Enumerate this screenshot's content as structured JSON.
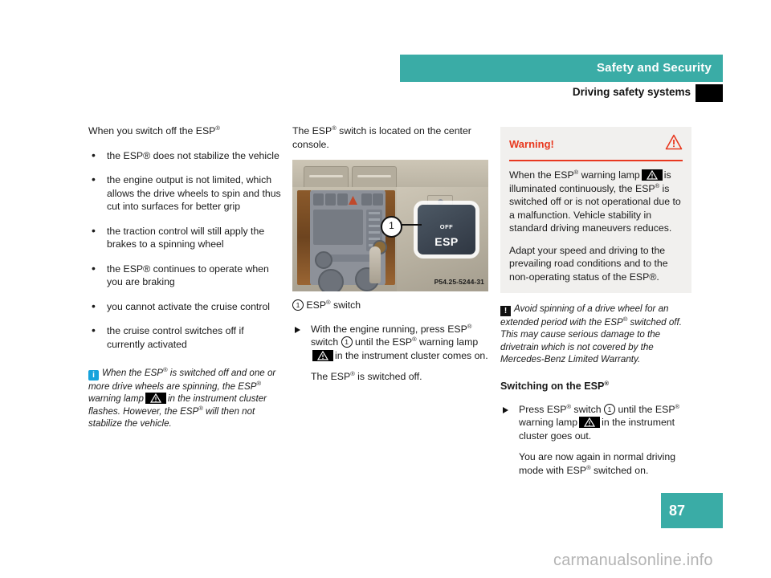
{
  "header": {
    "section_title": "Safety and Security",
    "subsection_title": "Driving safety systems"
  },
  "left_column": {
    "intro": "When you switch off the ESP",
    "bullets": [
      "the ESP® does not stabilize the vehicle",
      "the engine output is not limited, which allows the drive wheels to spin and thus cut into surfaces for better grip",
      "the traction control will still apply the brakes to a spinning wheel",
      "the ESP® continues to operate when you are braking",
      "you cannot activate the cruise control",
      "the cruise control switches off if currently activated"
    ],
    "note_part1": "When the ESP",
    "note_part2": " is switched off and one or more drive wheels are spinning, the ESP",
    "note_part3": " warning lamp",
    "note_part4": "in the instrument cluster flashes. However, the ESP",
    "note_part5": " will then not stabilize the vehicle."
  },
  "middle_column": {
    "intro_part1": "The ESP",
    "intro_part2": " switch is located on the center console.",
    "figure": {
      "image_id": "P54.25-5244-31",
      "callout_number": "1",
      "button_label_top": "OFF",
      "button_label_main": "ESP",
      "caption_number": "1",
      "caption_part1": "ESP",
      "caption_part2": " switch"
    },
    "step_part1": "With the engine running, press ESP",
    "step_part2": " switch",
    "step_callout": "1",
    "step_part3": "until the ESP",
    "step_part4": " warning lamp",
    "step_part5": "in the instrument cluster comes on.",
    "result_part1": "The ESP",
    "result_part2": " is switched off."
  },
  "right_column": {
    "warning_box": {
      "title": "Warning!",
      "icon": "warning-triangle-icon",
      "accent_color": "#e8381f",
      "background_color": "#f1f0ee",
      "para1_part1": "When the ESP",
      "para1_part2": " warning lamp",
      "para1_part3": "is illuminated continuously, the ESP",
      "para1_part4": " is switched off or is not operational due to a malfunction. Vehicle stability in standard driving maneuvers reduces.",
      "para2": "Adapt your speed and driving to the prevailing road conditions and to the non-operating status of the ESP®."
    },
    "caution_note_part1": "Avoid spinning of a drive wheel for an extended period with the ESP",
    "caution_note_part2": " switched off. This may cause serious damage to the drivetrain which is not covered by the Mercedes-Benz Limited Warranty.",
    "section_heading_part1": "Switching on the ESP",
    "step_part1": "Press ESP",
    "step_part2": " switch",
    "step_callout": "1",
    "step_part3": "until the ESP",
    "step_part4": " warning lamp",
    "step_part5": "in the instrument cluster goes out.",
    "result_part1": "You are now again in normal driving mode with ESP",
    "result_part2": " switched on."
  },
  "footer": {
    "page_number": "87",
    "watermark": "carmanualsonline.info",
    "accent_color": "#3aaca6"
  }
}
